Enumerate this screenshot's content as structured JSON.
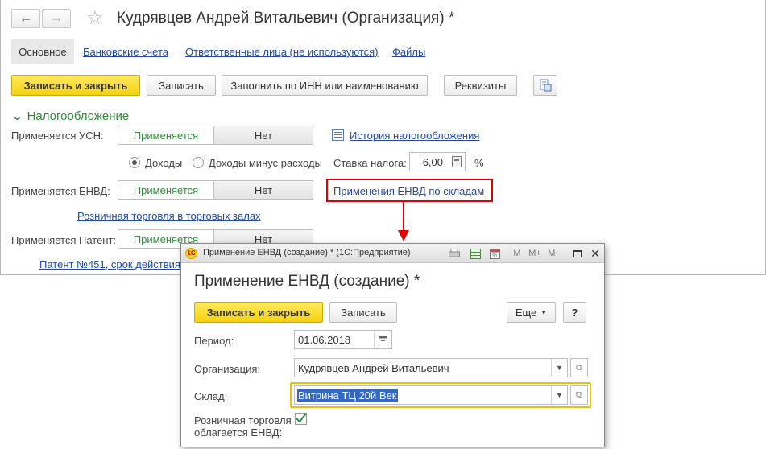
{
  "main": {
    "title": "Кудрявцев Андрей Витальевич (Организация) *",
    "tabs": [
      "Основное",
      "Банковские счета",
      "Ответственные лица (не используются)",
      "Файлы"
    ],
    "toolbar": {
      "save_close": "Записать и закрыть",
      "save": "Записать",
      "fill_inn": "Заполнить по ИНН или наименованию",
      "requisites": "Реквизиты"
    },
    "section_title": "Налогообложение",
    "usn": {
      "label": "Применяется УСН:",
      "on": "Применяется",
      "off": "Нет"
    },
    "tax_history_link": "История налогообложения",
    "radio_income": "Доходы",
    "radio_income_minus": "Доходы минус расходы",
    "tax_rate_label": "Ставка налога:",
    "tax_rate_value": "6,00",
    "percent_sign": "%",
    "envd": {
      "label": "Применяется ЕНВД:",
      "on": "Применяется",
      "off": "Нет"
    },
    "envd_link": "Применения ЕНВД по складам",
    "retail_link": "Розничная торговля в торговых залах",
    "patent": {
      "label": "Применяется Патент:",
      "on": "Применяется",
      "off": "Нет"
    },
    "patent_link": "Патент №451, срок действия"
  },
  "dialog": {
    "window_title": "Применение ЕНВД (создание) * (1С:Предприятие)",
    "logo_text": "1С",
    "heading": "Применение ЕНВД (создание) *",
    "save_close": "Записать и закрыть",
    "save": "Записать",
    "more": "Еще",
    "help": "?",
    "period_label": "Период:",
    "period_value": "01.06.2018",
    "org_label": "Организация:",
    "org_value": "Кудрявцев Андрей Витальевич",
    "warehouse_label": "Склад:",
    "warehouse_value": "Витрина ТЦ 20й Век",
    "retail_label_1": "Розничная торговля",
    "retail_label_2": "облагается ЕНВД:",
    "titlebar_icons": {
      "m": "M",
      "m_plus": "M+",
      "m_minus": "M−"
    }
  },
  "colors": {
    "accent_green": "#2e8b3a",
    "link_blue": "#1f4c9c",
    "primary_yellow": "#f5d20c",
    "highlight_red": "#e00000",
    "focus_border": "#f0c000"
  }
}
